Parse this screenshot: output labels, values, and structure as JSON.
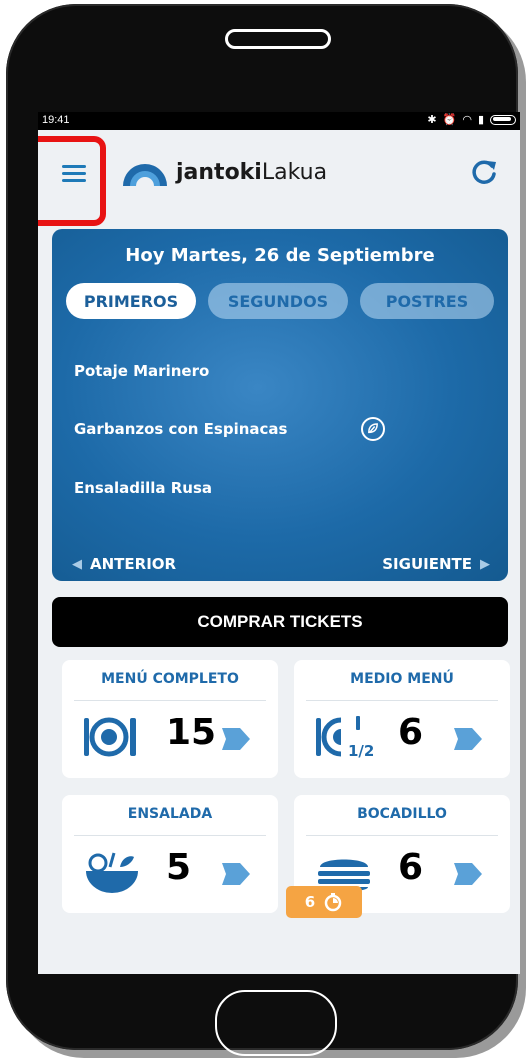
{
  "status": {
    "time": "19:41"
  },
  "header": {
    "brand_bold": "jantoki",
    "brand_light": "Lakua"
  },
  "menu": {
    "date": "Hoy Martes, 26 de Septiembre",
    "tabs": [
      {
        "label": "PRIMEROS"
      },
      {
        "label": "SEGUNDOS"
      },
      {
        "label": "POSTRES"
      }
    ],
    "dishes": [
      {
        "name": "Potaje Marinero"
      },
      {
        "name": "Garbanzos con Espinacas",
        "icon": "leaf-icon"
      },
      {
        "name": "Ensaladilla Rusa"
      }
    ],
    "prev_label": "ANTERIOR",
    "next_label": "SIGUIENTE"
  },
  "buy_label": "COMPRAR TICKETS",
  "cards": [
    {
      "title": "MENÚ COMPLETO",
      "count": "15",
      "icon": "full-menu-icon"
    },
    {
      "title": "MEDIO MENÚ",
      "count": "6",
      "icon": "half-menu-icon",
      "fraction": "1/2"
    },
    {
      "title": "ENSALADA",
      "count": "5",
      "icon": "salad-bowl-icon"
    },
    {
      "title": "BOCADILLO",
      "count": "6",
      "icon": "sandwich-icon"
    }
  ],
  "timer_badge": {
    "count": "6",
    "icon": "timer-icon"
  },
  "colors": {
    "primary": "#1f6aaa",
    "card_bg": "#1d6aa8",
    "highlight": "#e81313",
    "badge": "#f5a443",
    "ticket": "#5aa1d8"
  }
}
